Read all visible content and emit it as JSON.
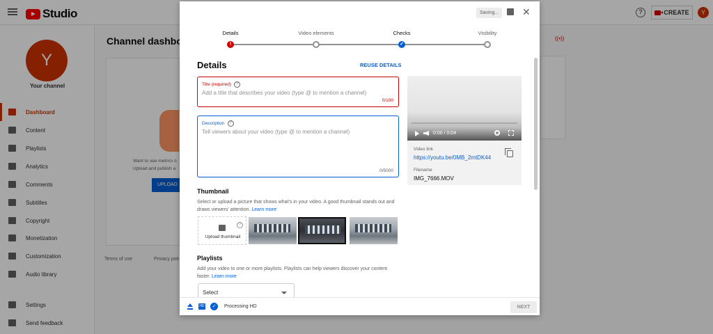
{
  "app": {
    "logo_text": "Studio",
    "create_label": "CREATE",
    "avatar_letter": "Y"
  },
  "sidebar": {
    "avatar_letter": "Y",
    "channel_label": "Your channel",
    "items": [
      {
        "label": "Dashboard"
      },
      {
        "label": "Content"
      },
      {
        "label": "Playlists"
      },
      {
        "label": "Analytics"
      },
      {
        "label": "Comments"
      },
      {
        "label": "Subtitles"
      },
      {
        "label": "Copyright"
      },
      {
        "label": "Monetization"
      },
      {
        "label": "Customization"
      },
      {
        "label": "Audio library"
      }
    ],
    "bottom_items": [
      {
        "label": "Settings"
      },
      {
        "label": "Send feedback"
      }
    ]
  },
  "background": {
    "title": "Channel dashboard",
    "card_text_1": "Want to see metrics o",
    "card_text_2": "Upload and publish a",
    "upload_button": "UPLOAD",
    "footer_links": [
      "Terms of use",
      "Privacy poli"
    ]
  },
  "modal": {
    "saving_label": "Saving...",
    "steps": [
      {
        "label": "Details",
        "state": "error"
      },
      {
        "label": "Video elements",
        "state": "pending"
      },
      {
        "label": "Checks",
        "state": "done"
      },
      {
        "label": "Visibility",
        "state": "pending"
      }
    ],
    "heading": "Details",
    "reuse_label": "REUSE DETAILS",
    "title_field": {
      "label": "Title (required)",
      "placeholder": "Add a title that describes your video (type @ to mention a channel)",
      "count": "0/100"
    },
    "description_field": {
      "label": "Description",
      "placeholder": "Tell viewers about your video (type @ to mention a channel)",
      "count": "0/5000"
    },
    "thumbnail": {
      "heading": "Thumbnail",
      "text": "Select or upload a picture that shows what's in your video. A good thumbnail stands out and draws viewers' attention.",
      "learn_more": "Learn more",
      "upload_label": "Upload thumbnail"
    },
    "playlists": {
      "heading": "Playlists",
      "text": "Add your video to one or more playlists. Playlists can help viewers discover your content faster.",
      "learn_more": "Learn more",
      "select_label": "Select"
    },
    "video": {
      "time": "0:00 / 0:04",
      "link_label": "Video link",
      "link": "https://youtu.be/0MB_2mtDK44",
      "filename_label": "Filename",
      "filename": "IMG_7666.MOV"
    },
    "footer": {
      "hd_badge": "HD",
      "status": "Processing HD",
      "next_label": "NEXT"
    }
  }
}
